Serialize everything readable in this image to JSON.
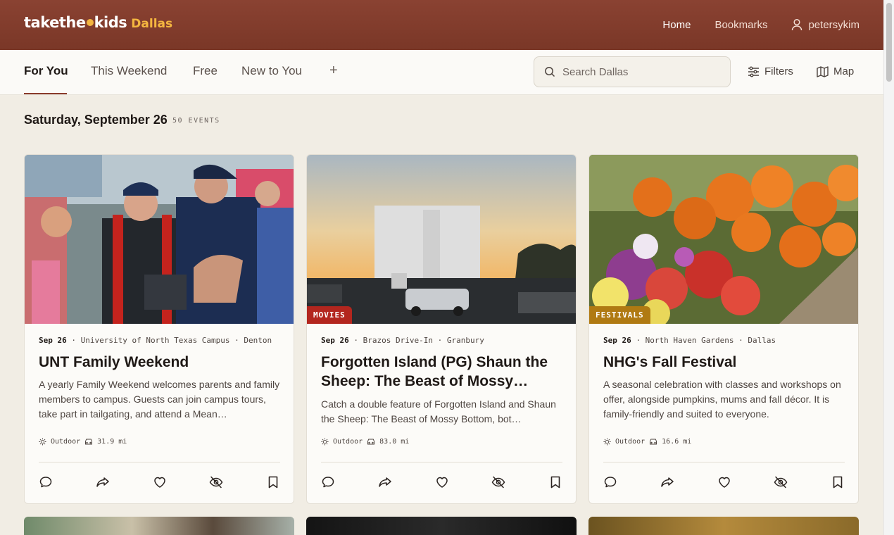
{
  "header": {
    "logo_text": "takethe kids",
    "logo_city": "Dallas",
    "nav": [
      {
        "label": "Home",
        "active": true
      },
      {
        "label": "Bookmarks",
        "active": false
      }
    ],
    "username": "petersykim"
  },
  "tabs": [
    {
      "label": "For You",
      "active": true
    },
    {
      "label": "This Weekend",
      "active": false
    },
    {
      "label": "Free",
      "active": false
    },
    {
      "label": "New to You",
      "active": false
    }
  ],
  "add_tab_label": "+",
  "search": {
    "placeholder": "Search Dallas",
    "value": ""
  },
  "tools": {
    "filters_label": "Filters",
    "map_label": "Map"
  },
  "section": {
    "date": "Saturday, September 26",
    "count": "50 EVENTS"
  },
  "cards": [
    {
      "badge": "",
      "date": "Sep 26",
      "venue": "University of North Texas Campus",
      "city": "Denton",
      "title": "UNT Family Weekend",
      "description": "A yearly Family Weekend welcomes parents and family members to campus. Guests can join campus tours, take part in tailgating, and attend a Mean…",
      "setting": "Outdoor",
      "distance": "31.9 mi"
    },
    {
      "badge": "MOVIES",
      "badge_color": "#b3261e",
      "date": "Sep 26",
      "venue": "Brazos Drive-In",
      "city": "Granbury",
      "title": "Forgotten Island (PG) Shaun the Sheep: The Beast of Mossy Botto…",
      "description": "Catch a double feature of Forgotten Island and Shaun the Sheep: The Beast of Mossy Bottom, bot…",
      "setting": "Outdoor",
      "distance": "83.0 mi"
    },
    {
      "badge": "FESTIVALS",
      "badge_color": "#b07a12",
      "date": "Sep 26",
      "venue": "North Haven Gardens",
      "city": "Dallas",
      "title": "NHG's Fall Festival",
      "description": "A seasonal celebration with classes and workshops on offer, alongside pumpkins, mums and fall décor. It is family-friendly and suited to everyone.",
      "setting": "Outdoor",
      "distance": "16.6 mi"
    }
  ],
  "card_actions": [
    "comment-icon",
    "share-icon",
    "heart-icon",
    "hide-icon",
    "bookmark-icon"
  ],
  "colors": {
    "header": "#7f3a2b",
    "accent": "#8a3b2b",
    "logo_accent": "#f4b640",
    "background": "#f1ede4"
  }
}
